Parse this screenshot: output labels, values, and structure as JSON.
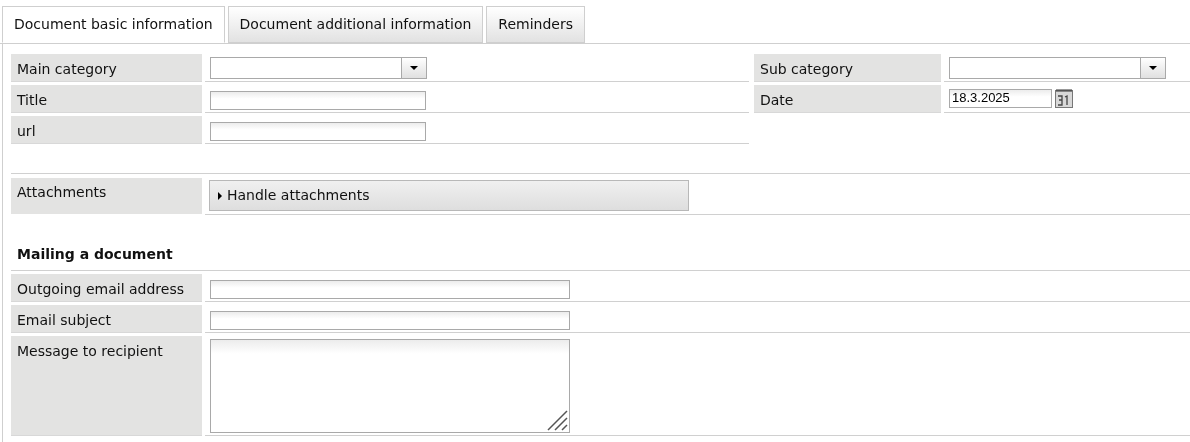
{
  "tabs": [
    {
      "label": "Document basic information",
      "selected": true
    },
    {
      "label": "Document additional information",
      "selected": false
    },
    {
      "label": "Reminders",
      "selected": false
    }
  ],
  "basic_left": [
    {
      "label": "Main category",
      "kind": "select"
    },
    {
      "label": "Title",
      "kind": "text"
    },
    {
      "label": "url",
      "kind": "text"
    }
  ],
  "basic_right": [
    {
      "label": "Sub category",
      "kind": "select"
    },
    {
      "label": "Date",
      "kind": "date",
      "value": "18.3.2025"
    }
  ],
  "attachments": {
    "label": "Attachments",
    "button": "Handle attachments"
  },
  "mailing": {
    "heading": "Mailing a document",
    "fields": [
      {
        "label": "Outgoing email address",
        "kind": "text"
      },
      {
        "label": "Email subject",
        "kind": "text"
      },
      {
        "label": "Message to recipient",
        "kind": "textarea"
      }
    ]
  }
}
